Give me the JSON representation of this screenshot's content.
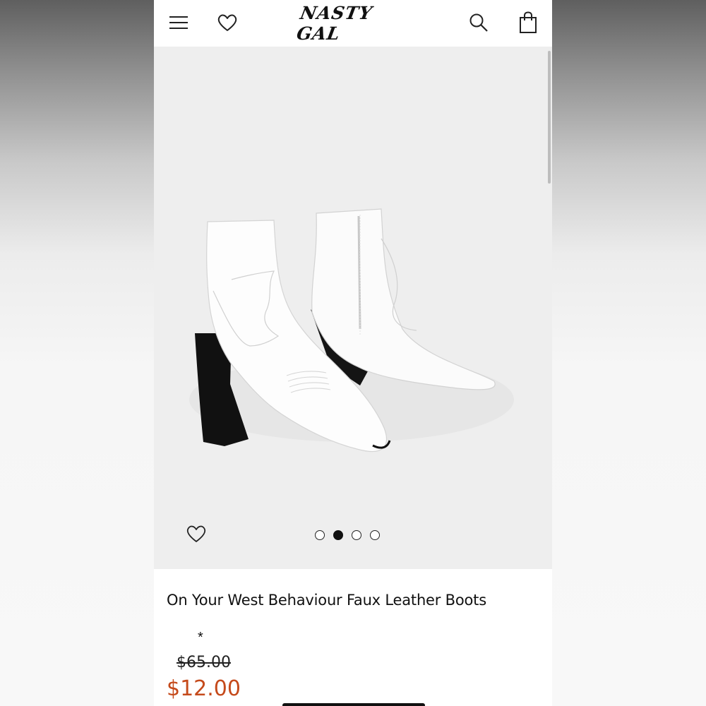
{
  "header": {
    "brand": "NASTY GAL",
    "menu_icon": "hamburger-menu-icon",
    "wishlist_icon": "heart-icon",
    "search_icon": "search-icon",
    "bag_icon": "shopping-bag-icon"
  },
  "gallery": {
    "image": "white western ankle boots",
    "favorite_icon": "heart-icon",
    "slide_count": 4,
    "active_slide": 2
  },
  "product": {
    "title": "On Your West Behaviour Faux Leather Boots",
    "marker": "*",
    "old_price": "$65.00",
    "new_price": "$12.00"
  },
  "colors": {
    "sale_price": "#c54a1b",
    "gallery_bg": "#eeeeee",
    "text": "#111111"
  }
}
